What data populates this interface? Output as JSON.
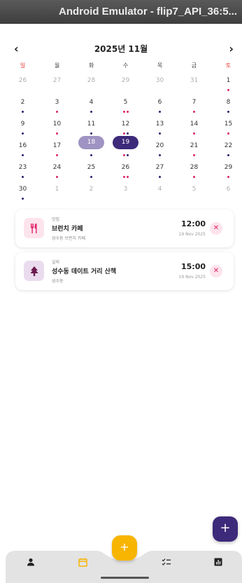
{
  "window": {
    "title": "Android Emulator - flip7_API_36:5..."
  },
  "calendar": {
    "prev_icon": "‹",
    "next_icon": "›",
    "month_label": "2025년 11월",
    "weekdays": [
      "일",
      "월",
      "화",
      "수",
      "목",
      "금",
      "토"
    ],
    "days": [
      {
        "d": "26",
        "other": true,
        "dots": []
      },
      {
        "d": "27",
        "other": true,
        "dots": []
      },
      {
        "d": "28",
        "other": true,
        "dots": []
      },
      {
        "d": "29",
        "other": true,
        "dots": []
      },
      {
        "d": "30",
        "other": true,
        "dots": []
      },
      {
        "d": "31",
        "other": true,
        "dots": []
      },
      {
        "d": "1",
        "dots": [
          "p"
        ]
      },
      {
        "d": "2",
        "dots": [
          "n"
        ]
      },
      {
        "d": "3",
        "dots": [
          "p"
        ]
      },
      {
        "d": "4",
        "dots": [
          "n"
        ]
      },
      {
        "d": "5",
        "dots": [
          "p",
          "p"
        ]
      },
      {
        "d": "6",
        "dots": [
          "n"
        ]
      },
      {
        "d": "7",
        "dots": [
          "p"
        ]
      },
      {
        "d": "8",
        "dots": [
          "n"
        ]
      },
      {
        "d": "9",
        "dots": [
          "n"
        ]
      },
      {
        "d": "10",
        "dots": [
          "p"
        ]
      },
      {
        "d": "11",
        "dots": [
          "n"
        ]
      },
      {
        "d": "12",
        "dots": [
          "p",
          "n"
        ]
      },
      {
        "d": "13",
        "dots": [
          "n"
        ]
      },
      {
        "d": "14",
        "dots": [
          "p"
        ]
      },
      {
        "d": "15",
        "dots": [
          "p"
        ]
      },
      {
        "d": "16",
        "dots": [
          "n"
        ]
      },
      {
        "d": "17",
        "dots": [
          "p"
        ]
      },
      {
        "d": "18",
        "dots": [
          "n"
        ],
        "state": "sel18"
      },
      {
        "d": "19",
        "dots": [
          "p",
          "n"
        ],
        "state": "sel19"
      },
      {
        "d": "20",
        "dots": [
          "n"
        ]
      },
      {
        "d": "21",
        "dots": [
          "p"
        ]
      },
      {
        "d": "22",
        "dots": [
          "n"
        ]
      },
      {
        "d": "23",
        "dots": [
          "n"
        ]
      },
      {
        "d": "24",
        "dots": [
          "p"
        ]
      },
      {
        "d": "25",
        "dots": [
          "n"
        ]
      },
      {
        "d": "26",
        "dots": [
          "p",
          "p"
        ]
      },
      {
        "d": "27",
        "dots": [
          "n"
        ]
      },
      {
        "d": "28",
        "dots": [
          "p"
        ]
      },
      {
        "d": "29",
        "dots": [
          "p"
        ]
      },
      {
        "d": "30",
        "dots": [
          "n"
        ]
      },
      {
        "d": "1",
        "other": true,
        "dots": []
      },
      {
        "d": "2",
        "other": true,
        "dots": []
      },
      {
        "d": "3",
        "other": true,
        "dots": []
      },
      {
        "d": "4",
        "other": true,
        "dots": []
      },
      {
        "d": "5",
        "other": true,
        "dots": []
      },
      {
        "d": "6",
        "other": true,
        "dots": []
      }
    ]
  },
  "colors": {
    "sunday": "#e53935",
    "saturday": "#e53935",
    "dot_navy": "#2d1f6e",
    "dot_pink": "#e0206a",
    "accent": "#3d2a7a",
    "fab_yellow": "#f7b500"
  },
  "events": [
    {
      "category": "맛집",
      "title": "브런치 카페",
      "subtitle": "성수동 브런치 카페",
      "time": "12:00",
      "date": "19 Nov 2025",
      "icon": "utensils-icon",
      "icon_bg": "#fde4ec",
      "icon_color": "#e0206a",
      "remove_icon": "✕"
    },
    {
      "category": "실외",
      "title": "성수동 데이트 거리 산책",
      "subtitle": "성수동",
      "time": "15:00",
      "date": "19 Nov 2025",
      "icon": "tree-icon",
      "icon_bg": "#eadcee",
      "icon_color": "#6b1a4e",
      "remove_icon": "✕"
    }
  ],
  "fab": {
    "add_icon": "+",
    "center_icon": "+"
  },
  "bottom_nav": [
    {
      "name": "profile",
      "icon": "person-icon",
      "active": false
    },
    {
      "name": "calendar",
      "icon": "calendar-icon",
      "active": true
    },
    {
      "name": "checklist",
      "icon": "checklist-icon",
      "active": false
    },
    {
      "name": "stats",
      "icon": "bar-chart-icon",
      "active": false
    }
  ]
}
